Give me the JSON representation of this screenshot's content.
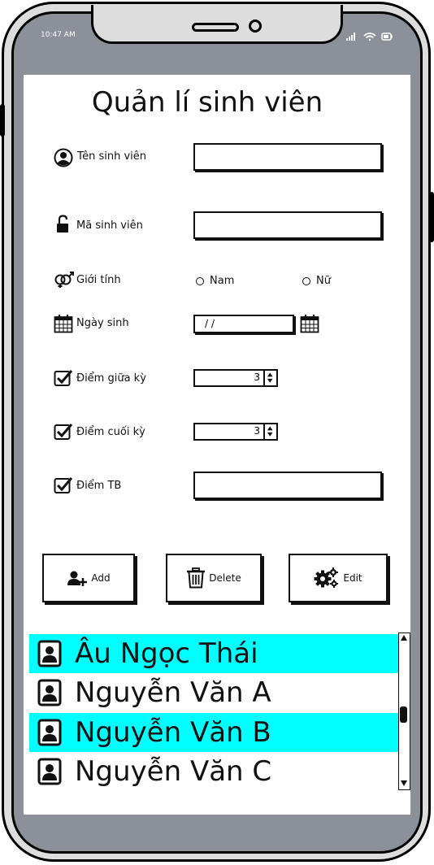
{
  "status_bar": {
    "time": "10:47 AM"
  },
  "app": {
    "title": "Quản lí sinh viên"
  },
  "form": {
    "name_label": "Tên sinh viên",
    "name_value": "",
    "id_label": "Mã sinh viên",
    "id_value": "",
    "gender_label": "Giới tính",
    "gender_options": [
      "Nam",
      "Nữ"
    ],
    "dob_label": "Ngày sinh",
    "dob_value": "/ /",
    "midterm_label": "Điểm giữa kỳ",
    "midterm_value": "3",
    "final_label": "Điểm cuối kỳ",
    "final_value": "3",
    "avg_label": "Điểm TB",
    "avg_value": ""
  },
  "buttons": {
    "add": "Add",
    "delete": "Delete",
    "edit": "Edit"
  },
  "student_list": {
    "items": [
      {
        "name": " Âu Ngọc Thái",
        "selected": true
      },
      {
        "name": "Nguyễn Văn A",
        "selected": false
      },
      {
        "name": "Nguyễn Văn B",
        "selected": true
      },
      {
        "name": "Nguyễn Văn C",
        "selected": false
      }
    ]
  },
  "colors": {
    "highlight": "#00ffff",
    "frame": "#8c9098"
  }
}
